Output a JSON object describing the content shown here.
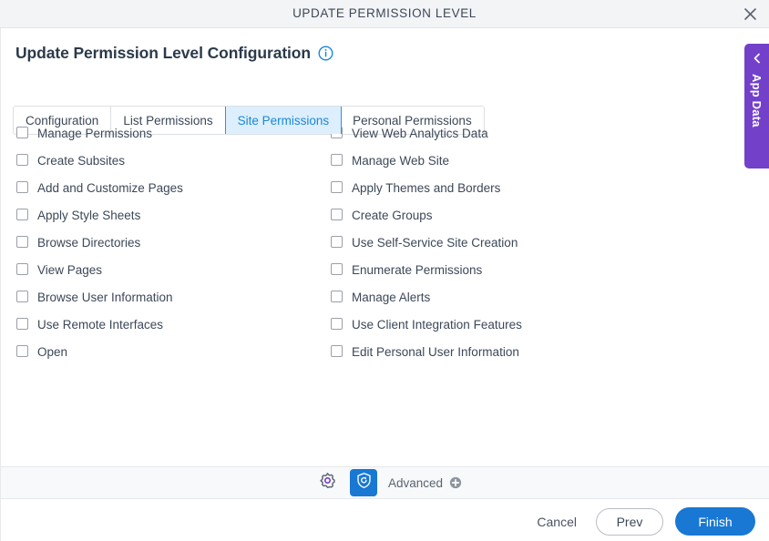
{
  "titlebar": {
    "title": "UPDATE PERMISSION LEVEL",
    "close_icon": "close-icon"
  },
  "header": {
    "page_title": "Update Permission Level Configuration",
    "info_icon": "info-icon"
  },
  "tabs": [
    {
      "label": "Configuration",
      "active": false
    },
    {
      "label": "List Permissions",
      "active": false
    },
    {
      "label": "Site Permissions",
      "active": true
    },
    {
      "label": "Personal Permissions",
      "active": false
    }
  ],
  "permissions": {
    "left_column": [
      {
        "label": "Manage Permissions",
        "checked": false
      },
      {
        "label": "Create Subsites",
        "checked": false
      },
      {
        "label": "Add and Customize Pages",
        "checked": false
      },
      {
        "label": "Apply Style Sheets",
        "checked": false
      },
      {
        "label": "Browse Directories",
        "checked": false
      },
      {
        "label": "View Pages",
        "checked": false
      },
      {
        "label": "Browse User Information",
        "checked": false
      },
      {
        "label": "Use Remote Interfaces",
        "checked": false
      },
      {
        "label": "Open",
        "checked": false
      }
    ],
    "right_column": [
      {
        "label": "View Web Analytics Data",
        "checked": false
      },
      {
        "label": "Manage Web Site",
        "checked": false
      },
      {
        "label": "Apply Themes and Borders",
        "checked": false
      },
      {
        "label": "Create Groups",
        "checked": false
      },
      {
        "label": "Use Self-Service Site Creation",
        "checked": false
      },
      {
        "label": "Enumerate Permissions",
        "checked": false
      },
      {
        "label": "Manage Alerts",
        "checked": false
      },
      {
        "label": "Use Client Integration Features",
        "checked": false
      },
      {
        "label": "Edit Personal User Information",
        "checked": false
      }
    ]
  },
  "toolbar": {
    "gear_icon": "gear-icon",
    "shield_refresh_icon": "shield-refresh-icon",
    "advanced_label": "Advanced",
    "plus_icon": "plus-circle-icon"
  },
  "footer": {
    "cancel_label": "Cancel",
    "prev_label": "Prev",
    "finish_label": "Finish"
  },
  "side_panel": {
    "label": "App Data",
    "collapse_icon": "chevron-left-icon"
  },
  "colors": {
    "accent_blue": "#1878d4",
    "active_tab_bg": "#ddeffc",
    "active_tab_text": "#1b87d8",
    "purple": "#7340c9",
    "gear_purple": "#7340c9",
    "titlebar_bg": "#f3f4f6",
    "toolstrip_bg": "#f8f9fa",
    "text": "#3c4858"
  }
}
